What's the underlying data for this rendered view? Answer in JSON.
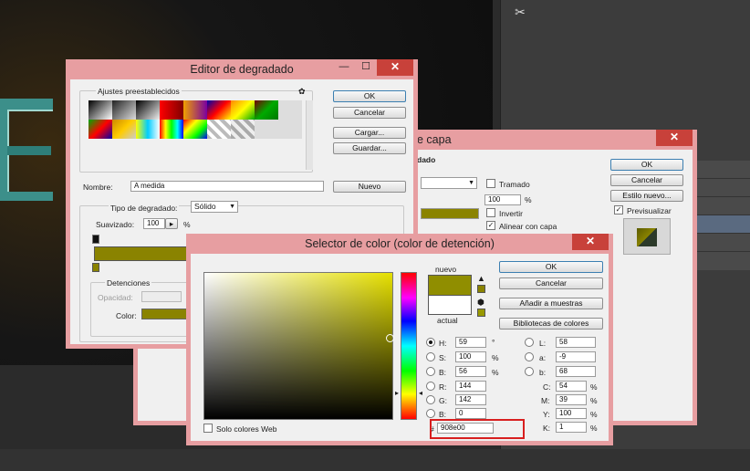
{
  "background": {
    "tool_icon": "tools-icon",
    "layer_style": {
      "title": "e capa",
      "ok": "OK",
      "cancel": "Cancelar",
      "new_style": "Estilo nuevo...",
      "preview": "Previsualizar",
      "section": "dado",
      "dither": "Tramado",
      "percent_value": "100",
      "percent_unit": "%",
      "invert": "Invertir",
      "align_layer": "Alinear con capa"
    }
  },
  "gradient_editor": {
    "title": "Editor de degradado",
    "presets_label": "Ajustes preestablecidos",
    "ok": "OK",
    "cancel": "Cancelar",
    "load": "Cargar...",
    "save": "Guardar...",
    "name_label": "Nombre:",
    "name_value": "A medida",
    "new": "Nuevo",
    "gradient_type_label": "Tipo de degradado:",
    "gradient_type_value": "Sólido",
    "smoothness_label": "Suavizado:",
    "smoothness_value": "100",
    "smoothness_unit": "%",
    "stops_label": "Detenciones",
    "opacity_label": "Opacidad:",
    "color_label": "Color:",
    "stop_color": "#8a8300"
  },
  "color_picker": {
    "title": "Selector de color (color de detención)",
    "new_label": "nuevo",
    "current_label": "actual",
    "ok": "OK",
    "cancel": "Cancelar",
    "add_swatches": "Añadir a muestras",
    "libraries": "Bibliotecas de colores",
    "web_only": "Solo colores Web",
    "hue_color": "#e6e000",
    "new_color": "#908e00",
    "current_color": "#ffffff",
    "fields": {
      "H": {
        "label": "H:",
        "value": "59",
        "unit": "°"
      },
      "S": {
        "label": "S:",
        "value": "100",
        "unit": "%"
      },
      "Bright": {
        "label": "B:",
        "value": "56",
        "unit": "%"
      },
      "R": {
        "label": "R:",
        "value": "144"
      },
      "G": {
        "label": "G:",
        "value": "142"
      },
      "Blue": {
        "label": "B:",
        "value": "0"
      },
      "L": {
        "label": "L:",
        "value": "58"
      },
      "a": {
        "label": "a:",
        "value": "-9"
      },
      "b": {
        "label": "b:",
        "value": "68"
      },
      "C": {
        "label": "C:",
        "value": "54",
        "unit": "%"
      },
      "M": {
        "label": "M:",
        "value": "39",
        "unit": "%"
      },
      "Y": {
        "label": "Y:",
        "value": "100",
        "unit": "%"
      },
      "K": {
        "label": "K:",
        "value": "1",
        "unit": "%"
      }
    },
    "hex_label": "#",
    "hex_value": "908e00"
  }
}
